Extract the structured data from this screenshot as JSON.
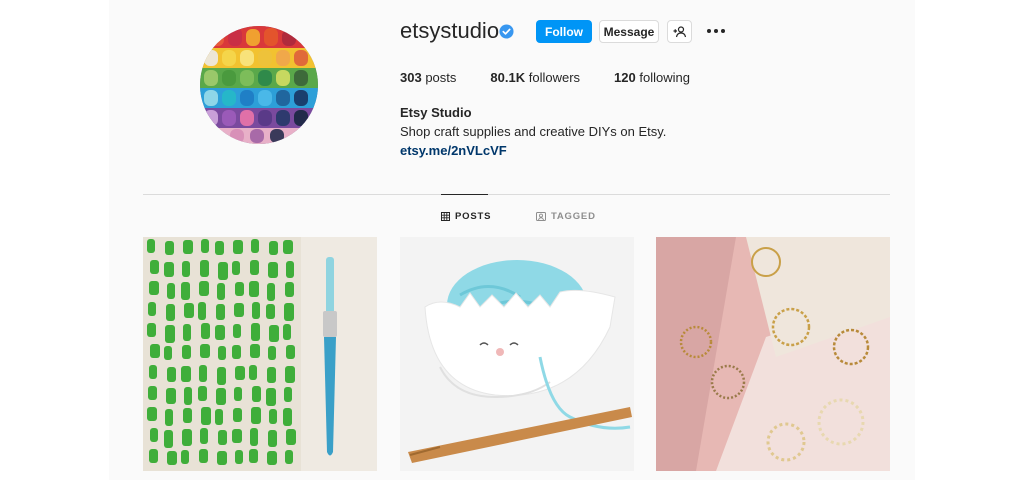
{
  "profile": {
    "username": "etsystudio",
    "full_name": "Etsy Studio",
    "bio": "Shop craft supplies and creative DIYs on Etsy.",
    "link": "etsy.me/2nVLcVF"
  },
  "actions": {
    "follow": "Follow",
    "message": "Message"
  },
  "stats": {
    "posts_count": "303",
    "posts_label": "posts",
    "followers_count": "80.1K",
    "followers_label": "followers",
    "following_count": "120",
    "following_label": "following"
  },
  "tabs": {
    "posts": "POSTS",
    "tagged": "TAGGED"
  },
  "colors": {
    "follow_button": "#0095f6",
    "verified_badge": "#3897f0",
    "link": "#00376b"
  },
  "icons": [
    "verified-badge-icon",
    "add-person-icon",
    "more-options-icon",
    "grid-icon",
    "tagged-icon"
  ]
}
